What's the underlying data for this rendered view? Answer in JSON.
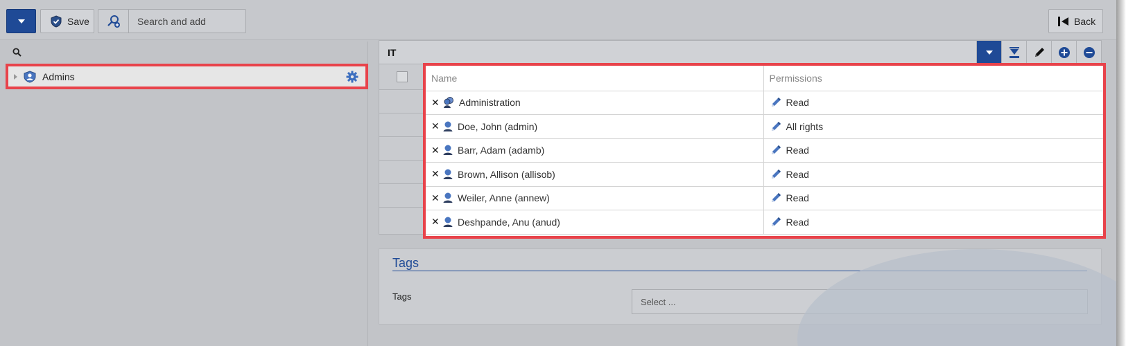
{
  "toolbar": {
    "save_label": "Save",
    "search_add_label": "Search and add",
    "back_label": "Back"
  },
  "tree": {
    "item_label": "Admins"
  },
  "grid": {
    "title": "IT",
    "columns": {
      "name": "Name",
      "permissions": "Permissions"
    },
    "rows": [
      {
        "name": "Administration",
        "permission": "Read",
        "type": "group"
      },
      {
        "name": "Doe, John (admin)",
        "permission": "All rights",
        "type": "user"
      },
      {
        "name": "Barr, Adam (adamb)",
        "permission": "Read",
        "type": "user"
      },
      {
        "name": "Brown, Allison (allisob)",
        "permission": "Read",
        "type": "user"
      },
      {
        "name": "Weiler, Anne (annew)",
        "permission": "Read",
        "type": "user"
      },
      {
        "name": "Deshpande, Anu (anud)",
        "permission": "Read",
        "type": "user"
      }
    ]
  },
  "tags": {
    "section_title": "Tags",
    "field_label": "Tags",
    "select_placeholder": "Select ..."
  },
  "colors": {
    "accent": "#1f4a96",
    "highlight_border": "#e8434b",
    "icon_blue": "#4a76c0"
  }
}
